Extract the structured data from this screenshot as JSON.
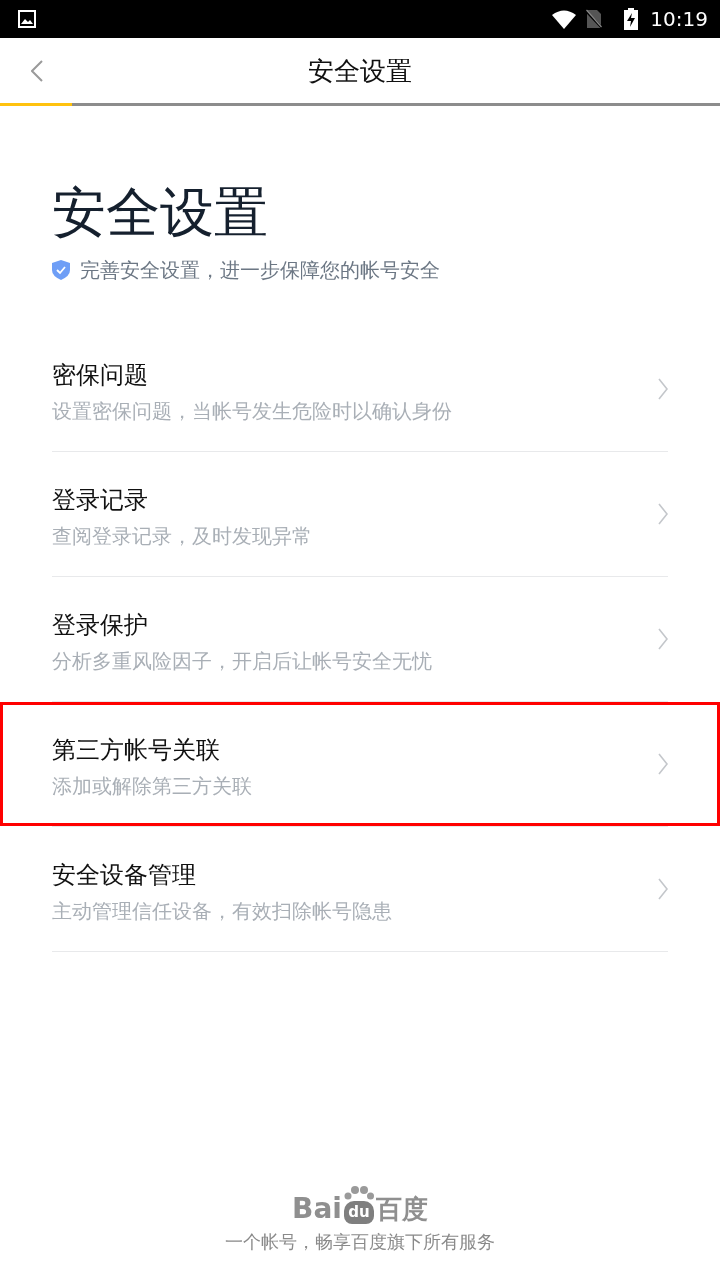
{
  "status_bar": {
    "time": "10:19"
  },
  "nav_bar": {
    "title": "安全设置",
    "progress": {
      "level": 0.1
    }
  },
  "header": {
    "title": "安全设置",
    "subtitle": "完善安全设置，进一步保障您的帐号安全"
  },
  "items": [
    {
      "title": "密保问题",
      "description": "设置密保问题，当帐号发生危险时以确认身份",
      "highlighted": false
    },
    {
      "title": "登录记录",
      "description": "查阅登录记录，及时发现异常",
      "highlighted": false
    },
    {
      "title": "登录保护",
      "description": "分析多重风险因子，开启后让帐号安全无忧",
      "highlighted": false
    },
    {
      "title": "第三方帐号关联",
      "description": "添加或解除第三方关联",
      "highlighted": true
    },
    {
      "title": "安全设备管理",
      "description": "主动管理信任设备，有效扫除帐号隐患",
      "highlighted": false
    }
  ],
  "footer": {
    "logo": {
      "latin": "Bai",
      "paw": "du",
      "chinese": "百度"
    },
    "tagline": "一个帐号，畅享百度旗下所有服务"
  }
}
